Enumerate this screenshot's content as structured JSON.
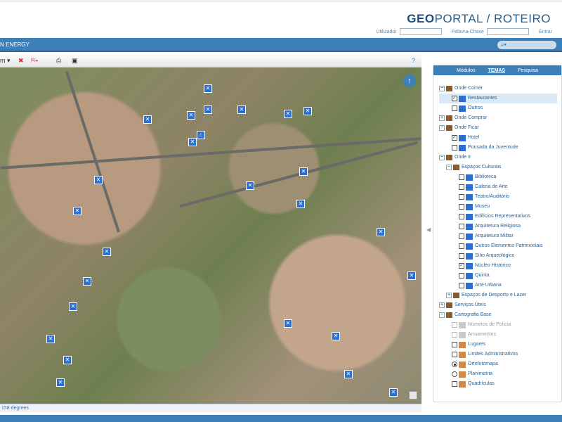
{
  "header": {
    "brand_bold": "GEO",
    "brand_rest": "PORTAL / ROTEIRO",
    "user_label": "Utilizador",
    "pass_label": "Palavra-Chave",
    "login_label": "Entrar"
  },
  "bar": {
    "title": "N ENERGY"
  },
  "map": {
    "status": "158 degrees",
    "north_symbol": "↑"
  },
  "tabs": [
    {
      "label": "Módulos"
    },
    {
      "label": "TEMAS"
    },
    {
      "label": "Pesquisa"
    }
  ],
  "tree": [
    {
      "label": "Onde Comer"
    },
    {
      "label": "Restaurantes"
    },
    {
      "label": "Outros"
    },
    {
      "label": "Onde Comprar"
    },
    {
      "label": "Onde Ficar"
    },
    {
      "label": "Hotel"
    },
    {
      "label": "Pousada da Juventude"
    },
    {
      "label": "Onde Ir"
    },
    {
      "label": "Espaços Culturais"
    },
    {
      "label": "Biblioteca"
    },
    {
      "label": "Galeria de Arte"
    },
    {
      "label": "Teatro/Auditório"
    },
    {
      "label": "Museu"
    },
    {
      "label": "Edifícios Representativos"
    },
    {
      "label": "Arquitetura Religiosa"
    },
    {
      "label": "Arquitetura Militar"
    },
    {
      "label": "Outros Elementos Patrimoniais"
    },
    {
      "label": "Sítio Arqueológico"
    },
    {
      "label": "Núcleo Histórico"
    },
    {
      "label": "Quinta"
    },
    {
      "label": "Arte Urbana"
    },
    {
      "label": "Espaços de Desporto e Lazer"
    },
    {
      "label": "Serviços Úteis"
    },
    {
      "label": "Cartografia Base"
    },
    {
      "label": "Números de Polícia"
    },
    {
      "label": "Arruamentos"
    },
    {
      "label": "Lugares"
    },
    {
      "label": "Limites Administrativos"
    },
    {
      "label": "Ortofotomapa"
    },
    {
      "label": "Planimetria"
    },
    {
      "label": "Quadrículas"
    }
  ]
}
